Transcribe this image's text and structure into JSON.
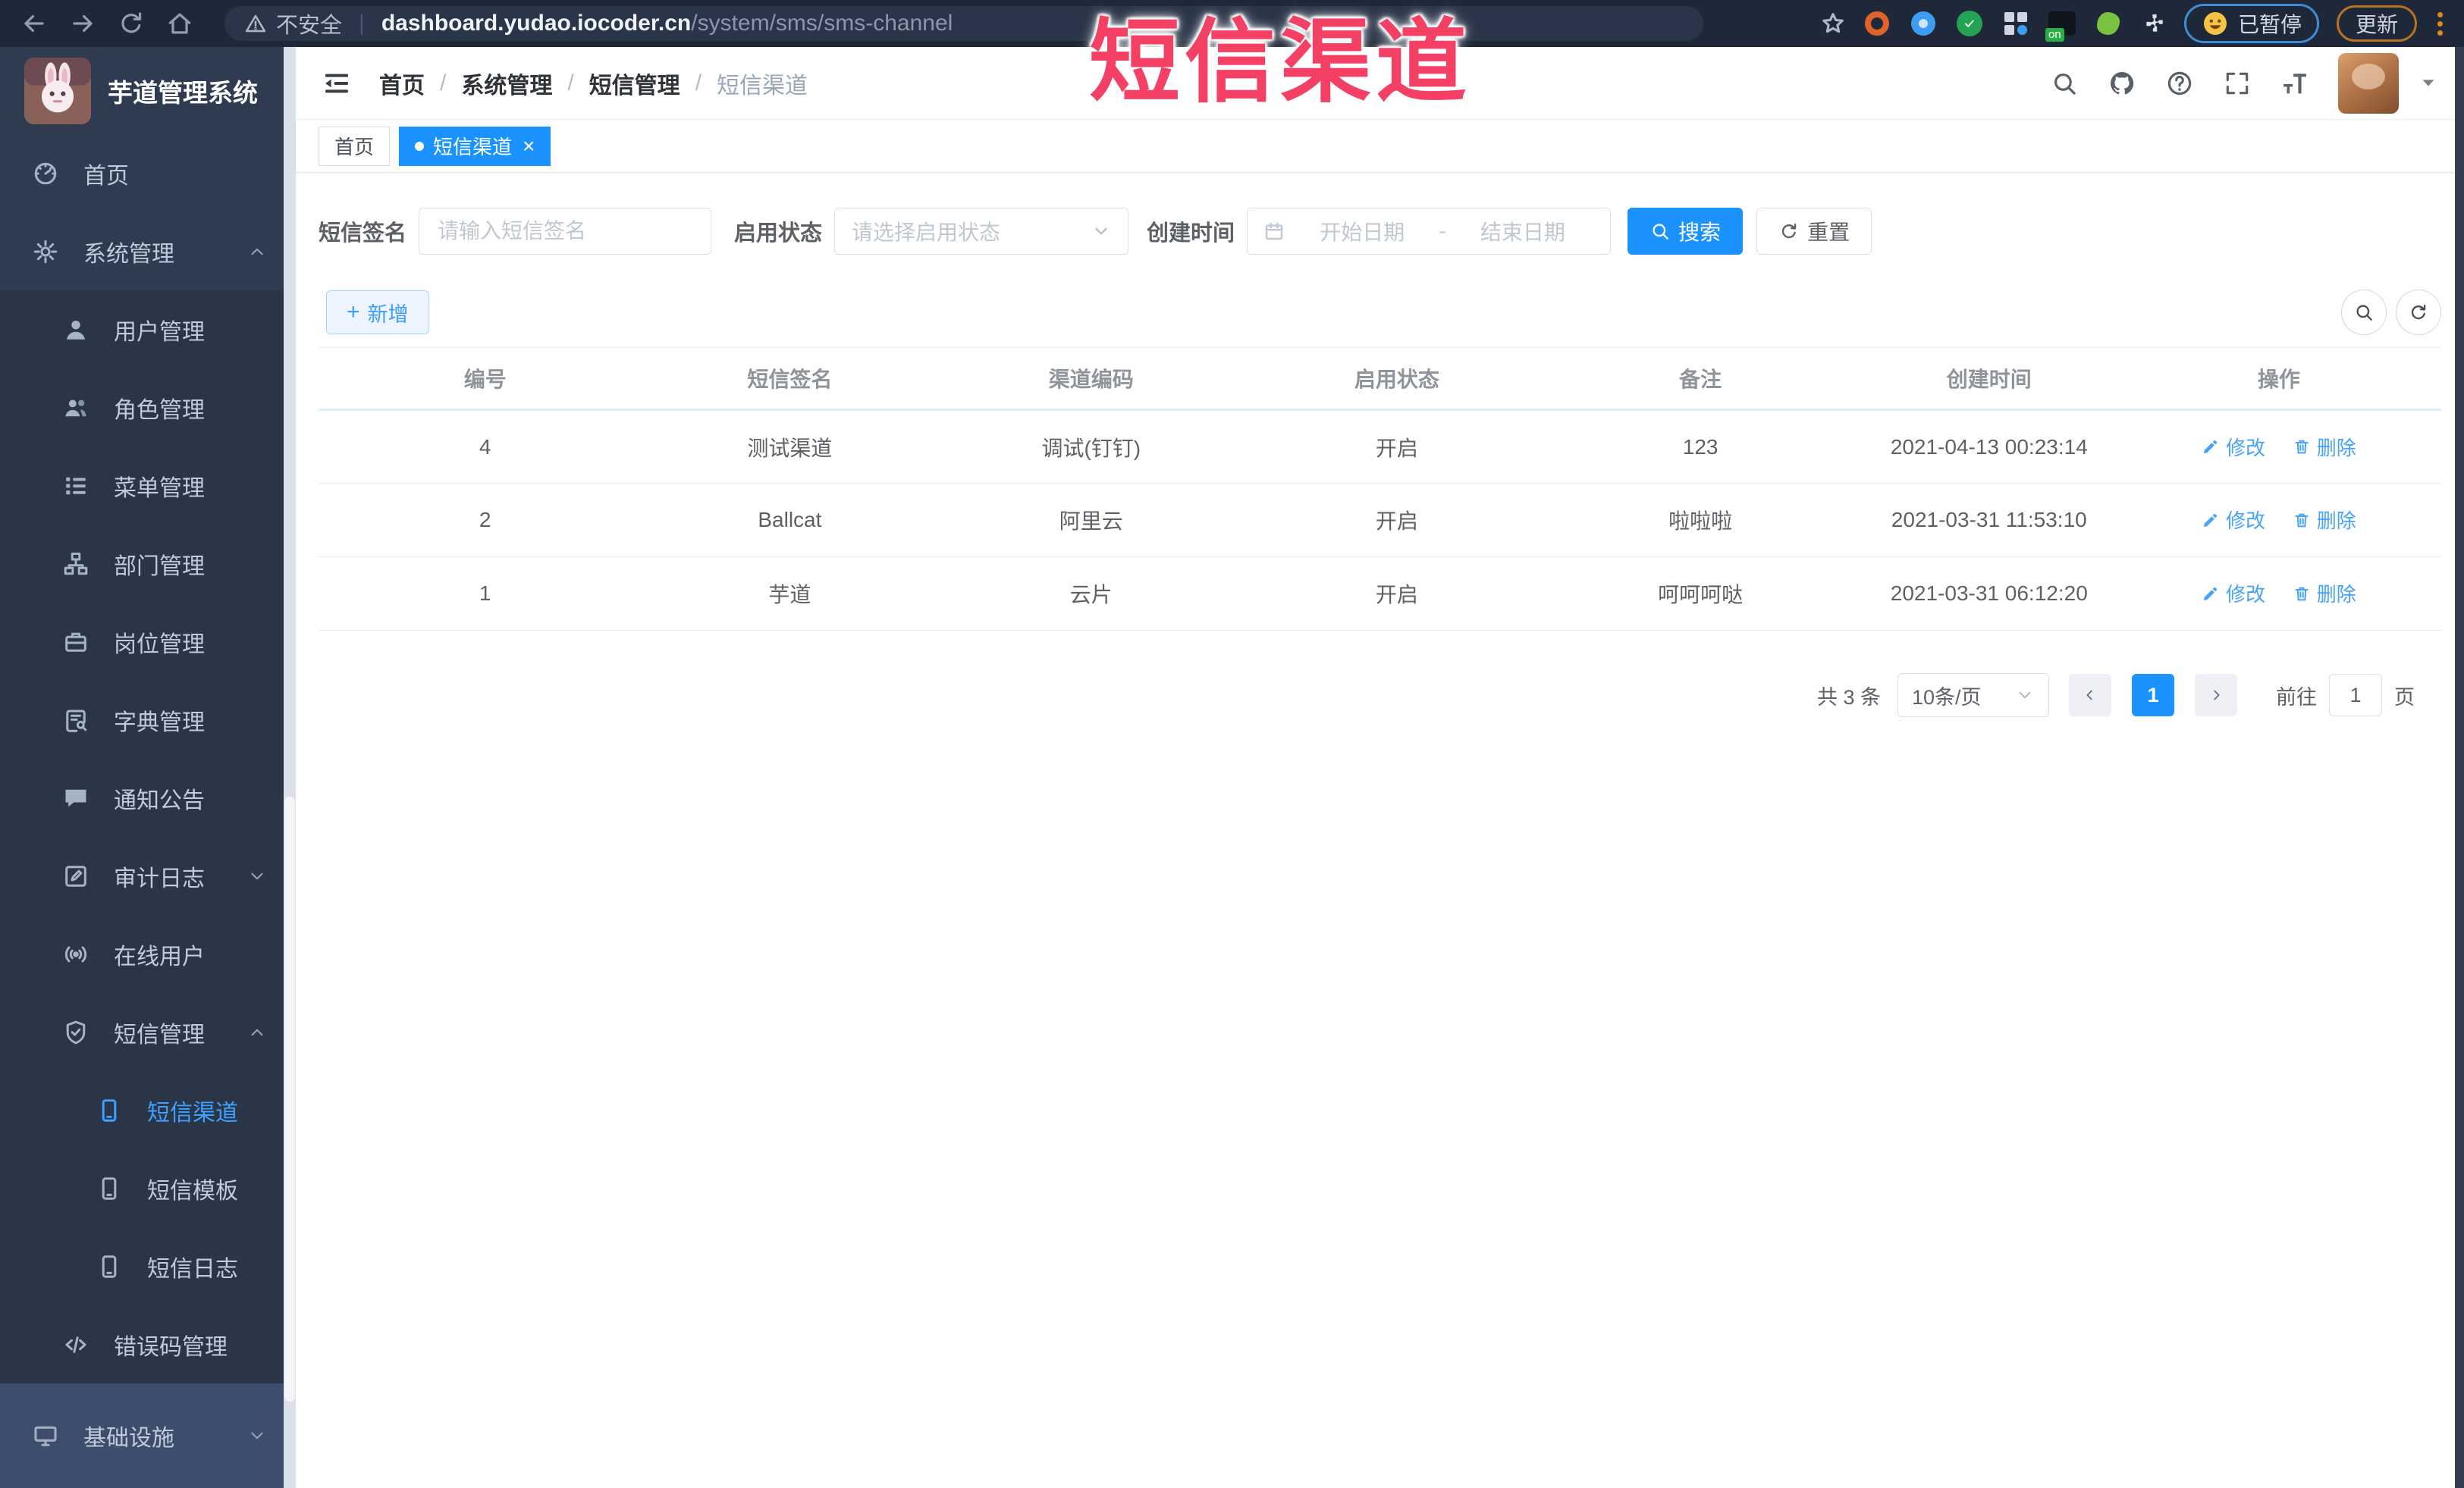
{
  "browser": {
    "security": "不安全",
    "url_host": "dashboard.yudao.iocoder.cn",
    "url_path": "/system/sms/sms-channel",
    "ext_badge": "on",
    "paused_label": "已暂停",
    "update_label": "更新"
  },
  "overlay": {
    "title": "短信渠道"
  },
  "sidebar": {
    "app_title": "芋道管理系统",
    "items": [
      {
        "label": "首页"
      },
      {
        "label": "系统管理"
      },
      {
        "label": "用户管理"
      },
      {
        "label": "角色管理"
      },
      {
        "label": "菜单管理"
      },
      {
        "label": "部门管理"
      },
      {
        "label": "岗位管理"
      },
      {
        "label": "字典管理"
      },
      {
        "label": "通知公告"
      },
      {
        "label": "审计日志"
      },
      {
        "label": "在线用户"
      },
      {
        "label": "短信管理"
      },
      {
        "label": "短信渠道"
      },
      {
        "label": "短信模板"
      },
      {
        "label": "短信日志"
      },
      {
        "label": "错误码管理"
      },
      {
        "label": "基础设施"
      }
    ]
  },
  "header": {
    "breadcrumb": [
      "首页",
      "系统管理",
      "短信管理",
      "短信渠道"
    ],
    "separator": "/"
  },
  "tabs": {
    "items": [
      {
        "label": "首页"
      },
      {
        "label": "短信渠道"
      }
    ],
    "close": "×"
  },
  "filters": {
    "sign_label": "短信签名",
    "sign_placeholder": "请输入短信签名",
    "status_label": "启用状态",
    "status_placeholder": "请选择启用状态",
    "time_label": "创建时间",
    "start_placeholder": "开始日期",
    "range_separator": "-",
    "end_placeholder": "结束日期",
    "search": "搜索",
    "reset": "重置"
  },
  "toolbar": {
    "add": "新增",
    "plus": "+"
  },
  "table": {
    "columns": [
      "编号",
      "短信签名",
      "渠道编码",
      "启用状态",
      "备注",
      "创建时间",
      "操作"
    ],
    "rows": [
      {
        "id": "4",
        "sign": "测试渠道",
        "code": "调试(钉钉)",
        "status": "开启",
        "remark": "123",
        "created": "2021-04-13 00:23:14"
      },
      {
        "id": "2",
        "sign": "Ballcat",
        "code": "阿里云",
        "status": "开启",
        "remark": "啦啦啦",
        "created": "2021-03-31 11:53:10"
      },
      {
        "id": "1",
        "sign": "芋道",
        "code": "云片",
        "status": "开启",
        "remark": "呵呵呵哒",
        "created": "2021-03-31 06:12:20"
      }
    ],
    "edit": "修改",
    "del": "删除"
  },
  "pagination": {
    "total": "共 3 条",
    "size": "10条/页",
    "page": "1",
    "goto": "前往",
    "goto_value": "1",
    "unit": "页"
  }
}
